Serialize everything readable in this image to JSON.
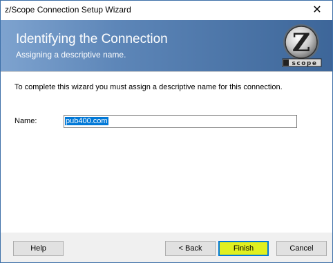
{
  "window": {
    "title": "z/Scope Connection Setup Wizard",
    "close_glyph": "✕"
  },
  "header": {
    "title": "Identifying the Connection",
    "subtitle": "Assigning a descriptive name.",
    "logo_letter": "Z",
    "logo_text": "scope"
  },
  "content": {
    "instruction": "To complete this wizard you must assign a descriptive name for this connection.",
    "name_label": "Name:",
    "name_value": "pub400.com"
  },
  "buttons": {
    "help": "Help",
    "back": "< Back",
    "finish": "Finish",
    "cancel": "Cancel"
  },
  "colors": {
    "header_start": "#7ea3cf",
    "header_end": "#3d6699",
    "highlight": "#e0f020",
    "selection": "#0078d7"
  }
}
